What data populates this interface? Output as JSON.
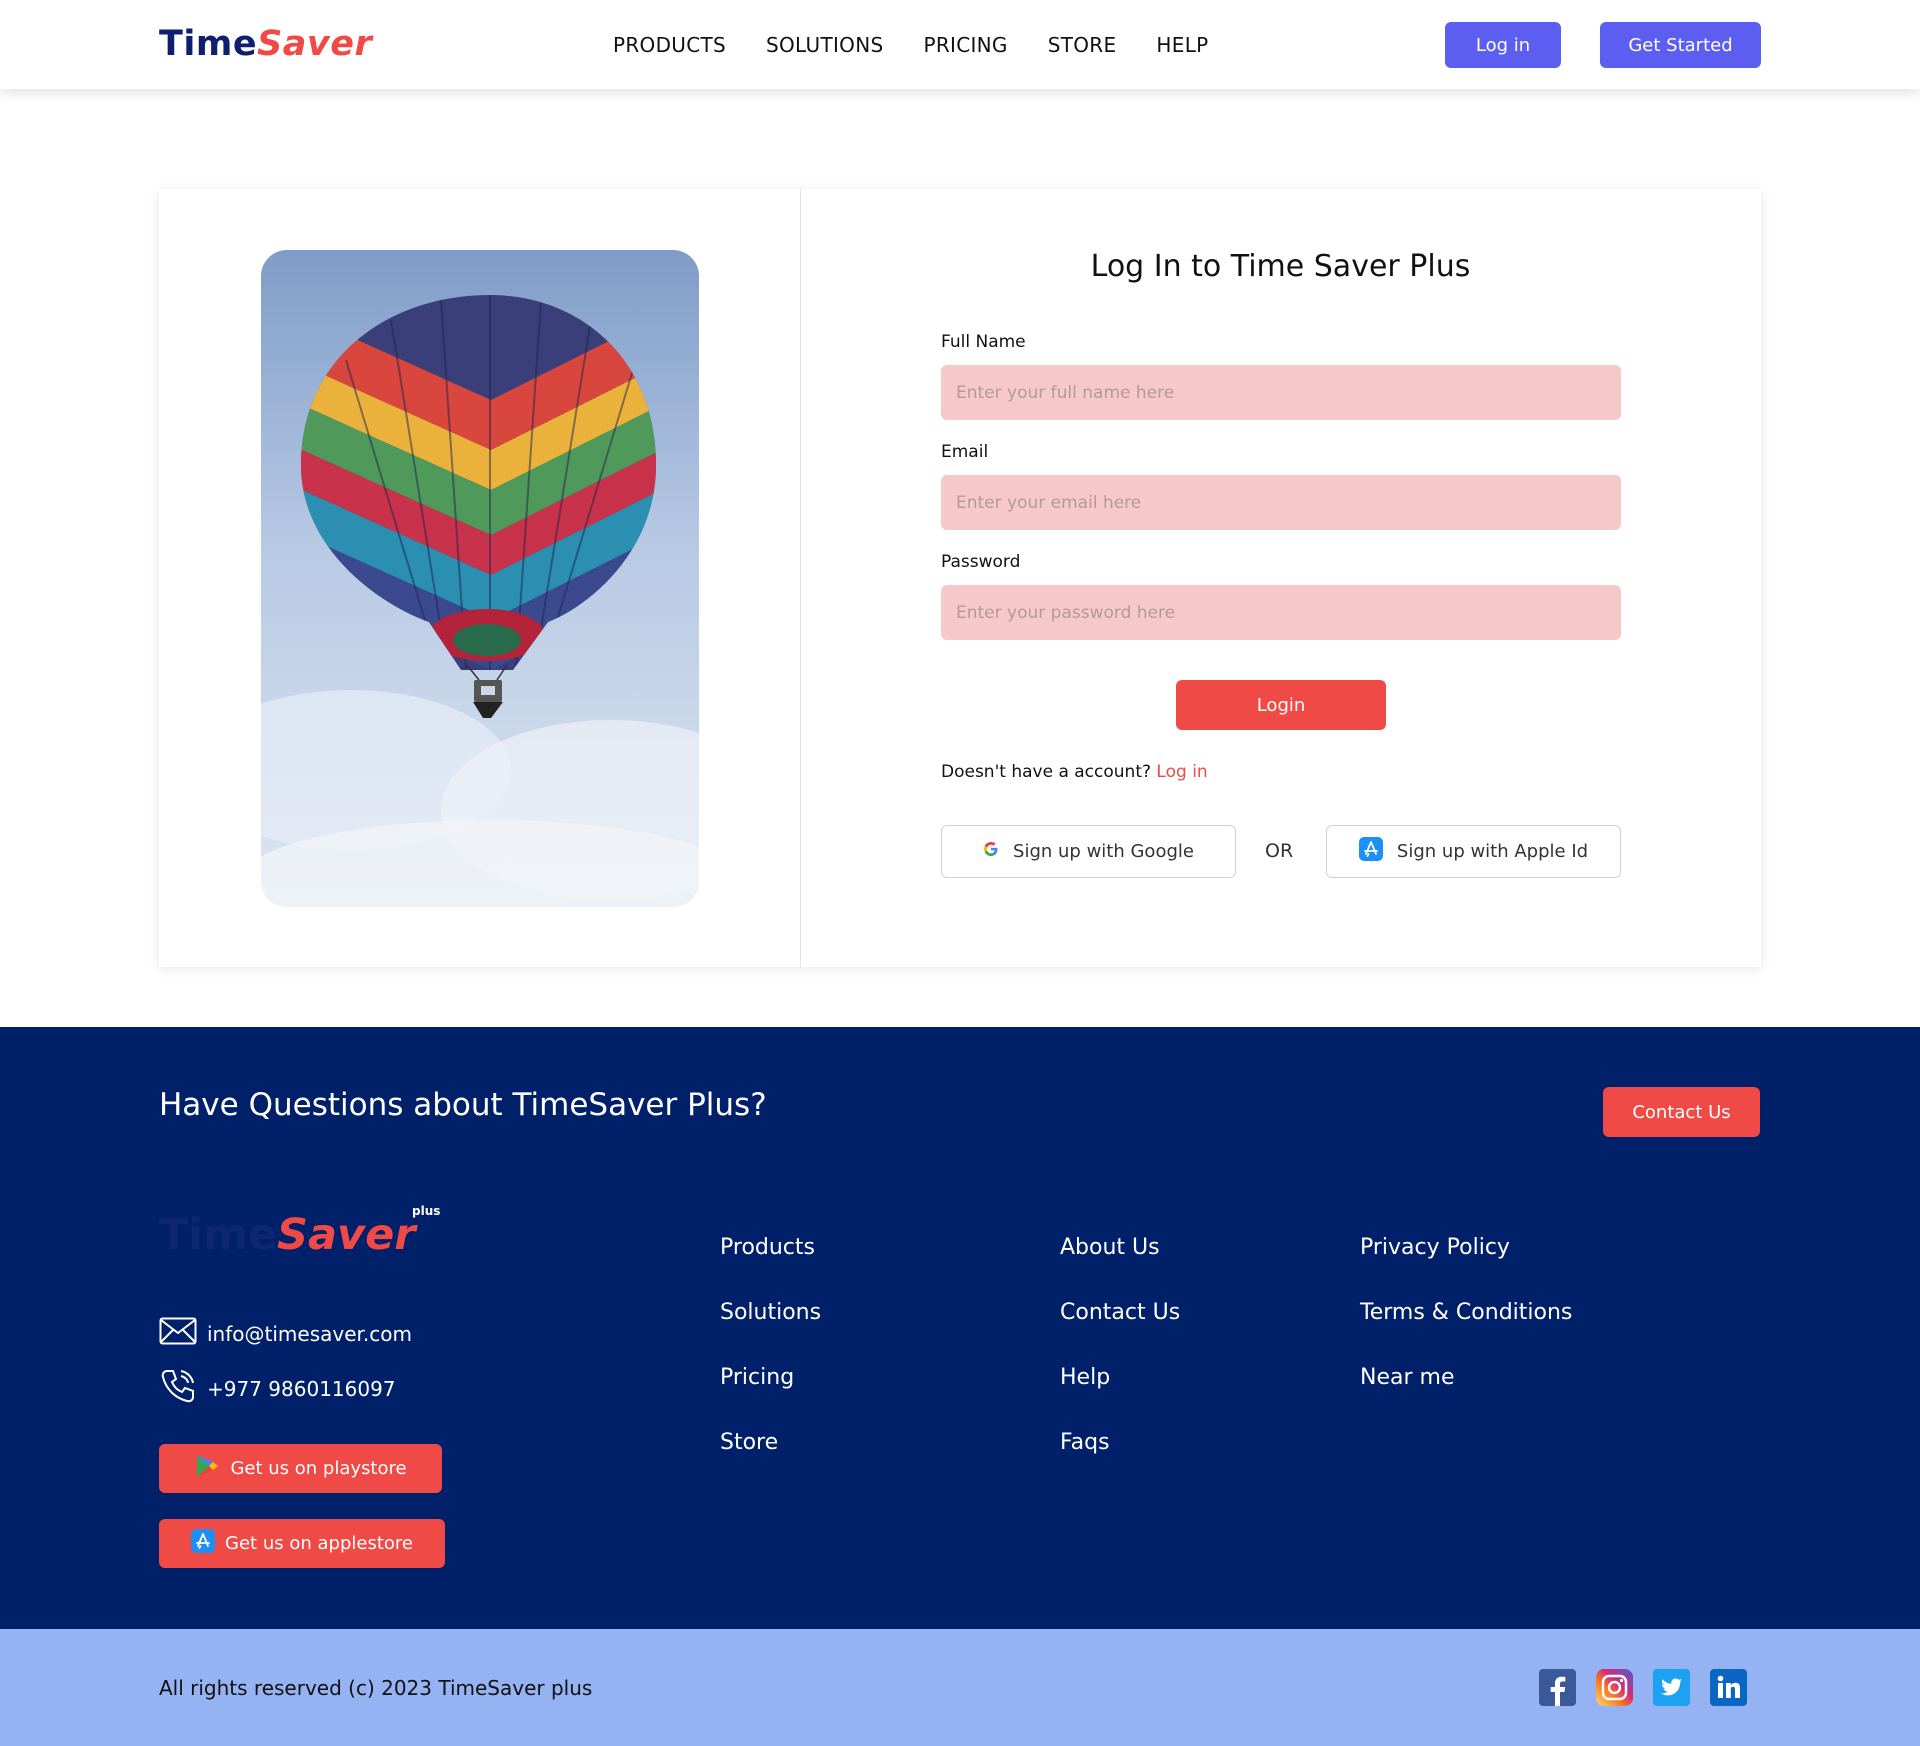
{
  "header": {
    "logo_part1": "Time",
    "logo_part2": "Saver",
    "nav": [
      "PRODUCTS",
      "SOLUTIONS",
      "PRICING",
      "STORE",
      "HELP"
    ],
    "login_label": "Log in",
    "get_started_label": "Get Started"
  },
  "form": {
    "title": "Log In to Time Saver Plus",
    "full_name_label": "Full Name",
    "full_name_placeholder": "Enter your full name here",
    "email_label": "Email",
    "email_placeholder": "Enter your email here",
    "password_label": "Password",
    "password_placeholder": "Enter your password here",
    "submit_label": "Login",
    "no_account_text": "Doesn't have a account?",
    "no_account_link": "Log in",
    "google_label": "Sign up with Google",
    "or_text": "OR",
    "apple_label": "Sign up with Apple Id"
  },
  "footer": {
    "question": "Have Questions about TimeSaver Plus?",
    "contact_button": "Contact Us",
    "logo_part1": "Time",
    "logo_part2": "Saver",
    "logo_plus": "plus",
    "email": "info@timesaver.com",
    "phone": "+977 9860116097",
    "playstore_label": "Get us on playstore",
    "applestore_label": "Get us on applestore",
    "col1": [
      "Products",
      "Solutions",
      "Pricing",
      "Store"
    ],
    "col2": [
      "About Us",
      "Contact Us",
      "Help",
      "Faqs"
    ],
    "col3": [
      "Privacy Policy",
      "Terms & Conditions",
      "Near me"
    ]
  },
  "bottom": {
    "copyright": "All rights reserved (c) 2023 TimeSaver plus"
  },
  "colors": {
    "primary": "#5b5ef0",
    "accent": "#ef4a45",
    "footer_bg": "#00206a",
    "bottom_bg": "#95b2f2",
    "input_bg": "#f7c8c8"
  },
  "icons": [
    "mail-icon",
    "phone-icon",
    "google-icon",
    "apple-store-icon",
    "play-store-icon",
    "facebook-icon",
    "instagram-icon",
    "twitter-icon",
    "linkedin-icon"
  ]
}
